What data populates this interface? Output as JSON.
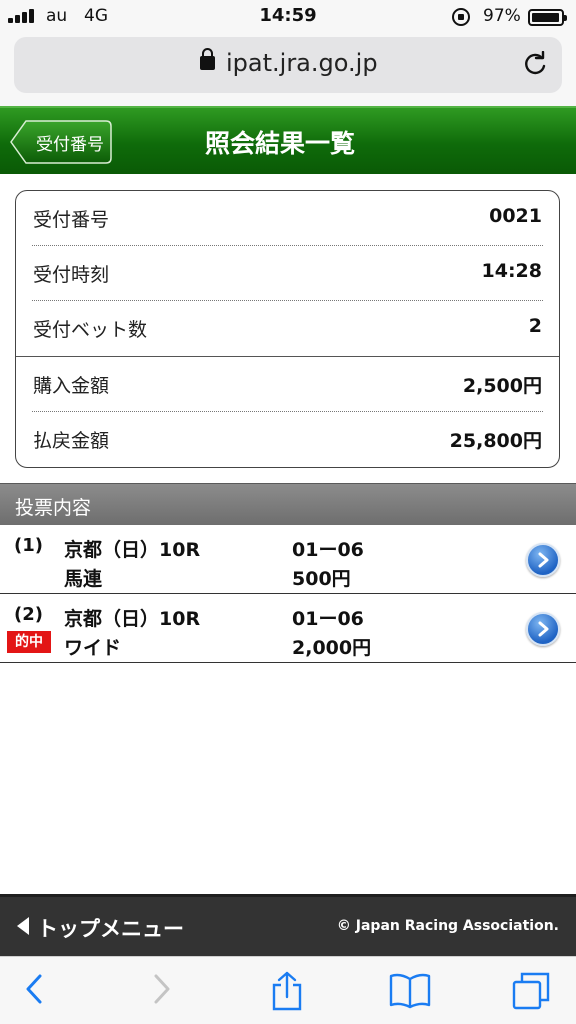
{
  "status_bar": {
    "carrier": "au",
    "network": "4G",
    "time": "14:59",
    "battery": "97%"
  },
  "browser": {
    "url": "ipat.jra.go.jp"
  },
  "header": {
    "back_label": "受付番号",
    "title": "照会結果一覧"
  },
  "summary": [
    {
      "label": "受付番号",
      "value": "0021"
    },
    {
      "label": "受付時刻",
      "value": "14:28"
    },
    {
      "label": "受付ベット数",
      "value": "2"
    },
    {
      "label": "購入金額",
      "value": "2,500円"
    },
    {
      "label": "払戻金額",
      "value": "25,800円"
    }
  ],
  "section": {
    "title": "投票内容"
  },
  "bets": [
    {
      "number": "(1)",
      "race": "京都（日）10R",
      "type": "馬連",
      "combination": "01ー06",
      "amount": "500円",
      "badge": ""
    },
    {
      "number": "(2)",
      "race": "京都（日）10R",
      "type": "ワイド",
      "combination": "01ー06",
      "amount": "2,000円",
      "badge": "的中"
    }
  ],
  "footer": {
    "top_menu": "トップメニュー",
    "copyright": "© Japan Racing Association."
  },
  "colors": {
    "header_green": "#1a7d12",
    "hit_red": "#e31616",
    "link_blue": "#1f63c4",
    "footer_gray": "#333333"
  },
  "icons": [
    "signal-icon",
    "rotation-lock-icon",
    "battery-icon",
    "padlock-icon",
    "reload-icon",
    "back-arrow-icon",
    "forward-arrow-icon",
    "share-icon",
    "bookmarks-icon",
    "tabs-icon",
    "chevron-right-icon"
  ]
}
